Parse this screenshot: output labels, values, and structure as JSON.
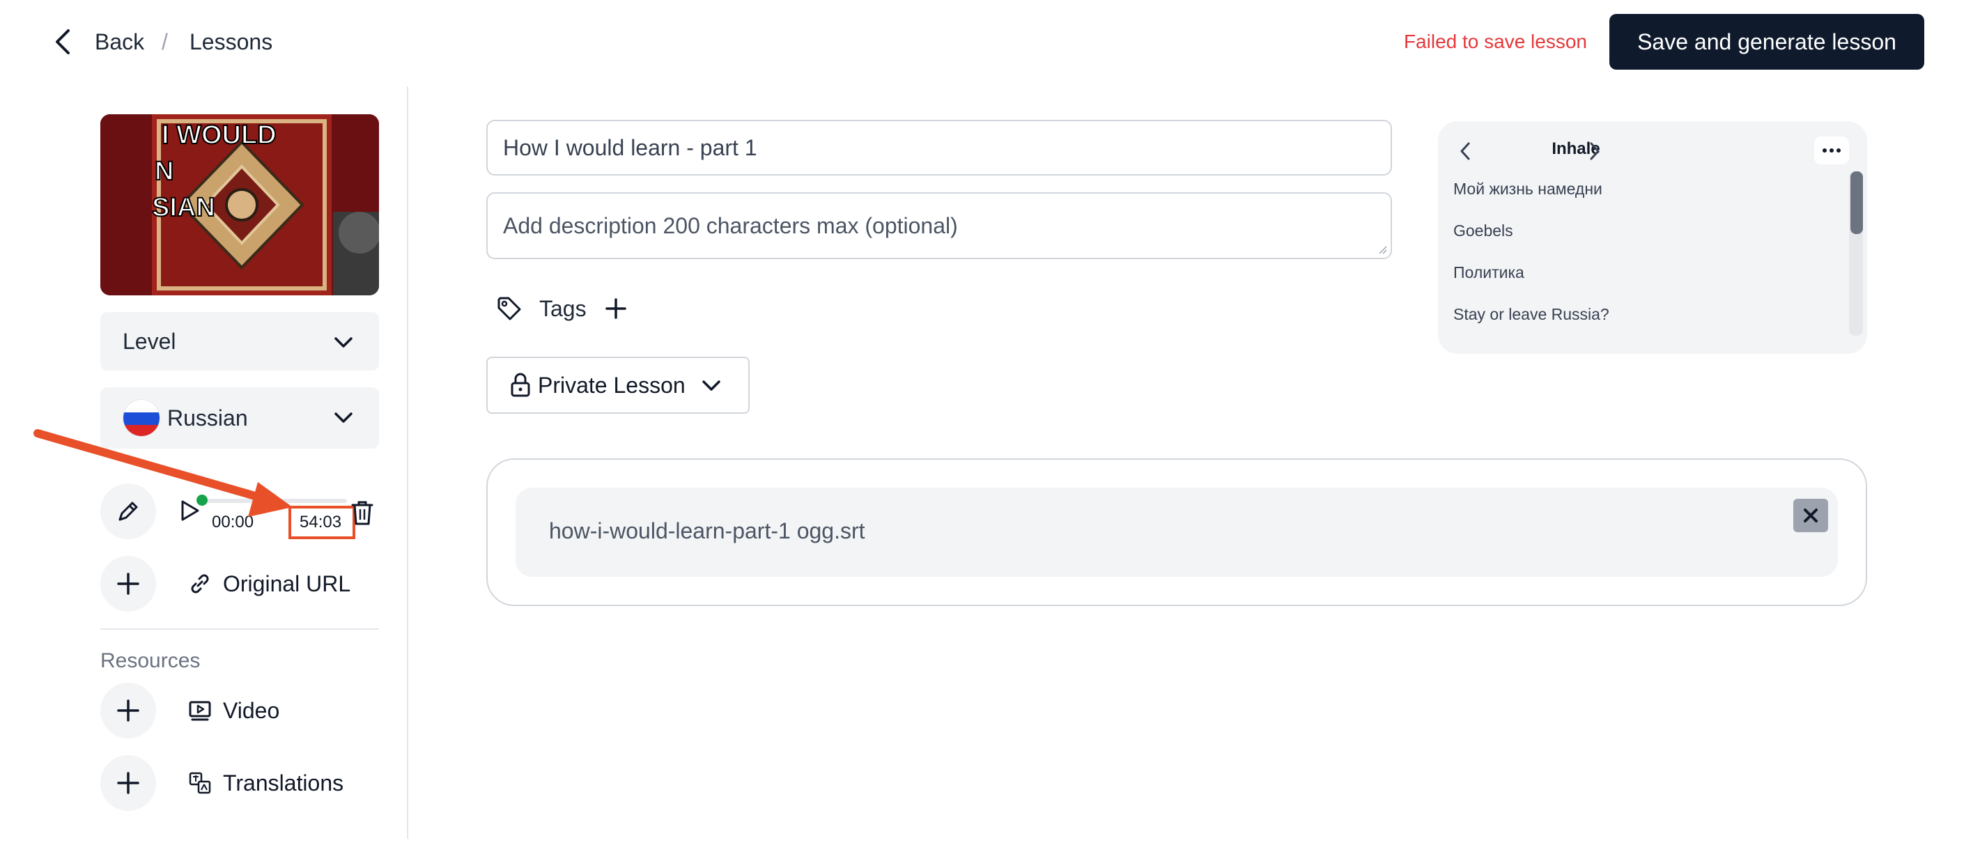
{
  "header": {
    "back_label": "Back",
    "separator": "/",
    "breadcrumb_current": "Lessons",
    "error_message": "Failed to save lesson",
    "primary_action": "Save and generate lesson"
  },
  "sidebar": {
    "thumbnail_text": [
      "I WOULD",
      "N",
      "SIAN"
    ],
    "level_select": {
      "value": "Level"
    },
    "language_select": {
      "value": "Russian"
    },
    "player": {
      "current_time": "00:00",
      "duration": "54:03",
      "progress": 0
    },
    "original_url_label": "Original URL",
    "resources_heading": "Resources",
    "resources": [
      {
        "label": "Video",
        "icon": "video-icon"
      },
      {
        "label": "Translations",
        "icon": "translate-icon"
      }
    ]
  },
  "form": {
    "title_value": "How I would learn - part 1",
    "description_placeholder": "Add description 200 characters max (optional)",
    "tags_label": "Tags",
    "privacy_label": "Private Lesson"
  },
  "collection_panel": {
    "title": "Inhale",
    "items": [
      "Мой жизнь намедни",
      "Goebels",
      "Политика",
      "Stay or leave Russia?"
    ]
  },
  "attachment": {
    "file_name": "how-i-would-learn-part-1 ogg.srt"
  },
  "colors": {
    "primary": "#0f1b2d",
    "error": "#e5383b",
    "annotation": "#e8502a",
    "progress_dot": "#16a34a"
  }
}
